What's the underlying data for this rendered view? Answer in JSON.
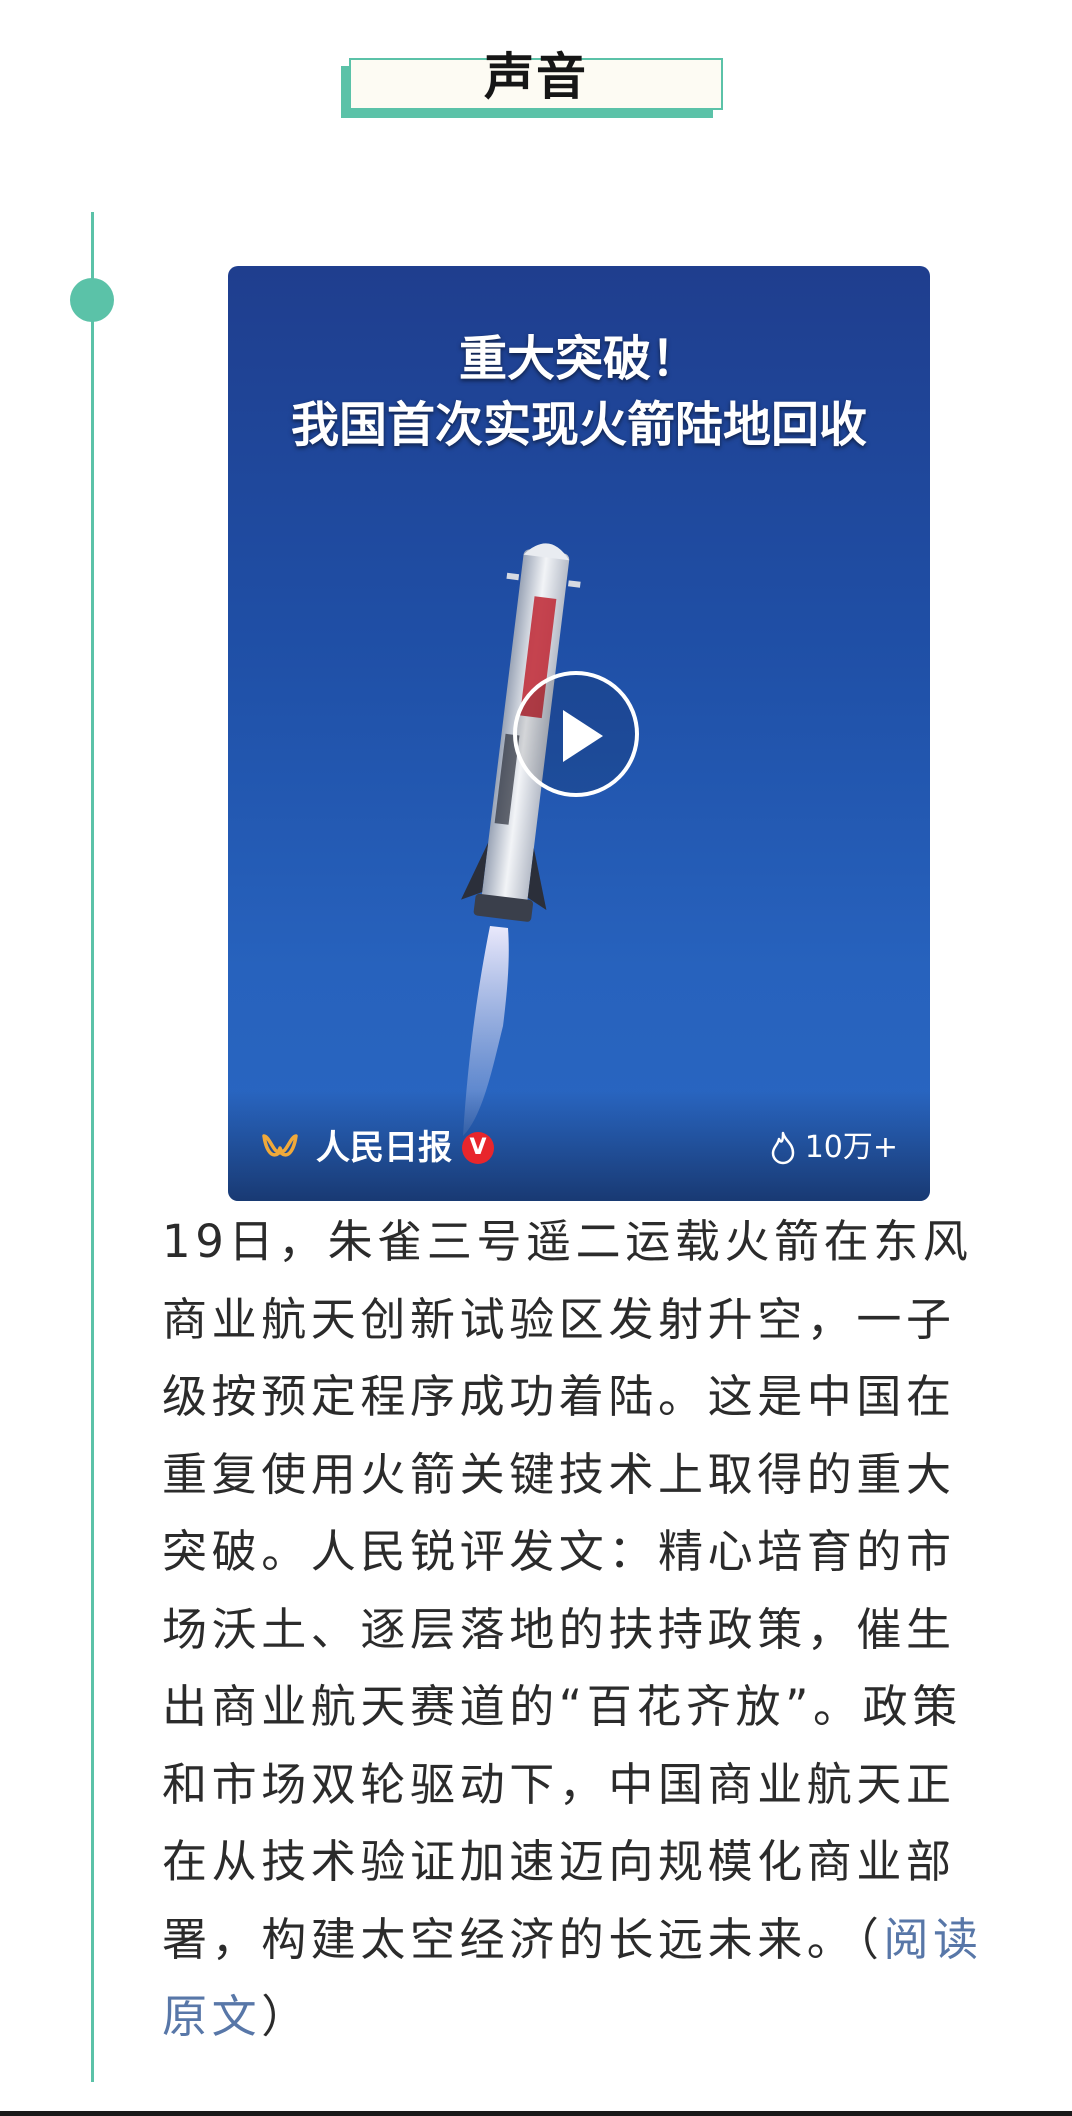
{
  "section": {
    "title": "声音"
  },
  "video": {
    "headline_line1": "重大突破！",
    "headline_line2": "我国首次实现火箭陆地回收",
    "source_name": "人民日报",
    "verified_mark": "V",
    "likes": "10万+",
    "icons": {
      "play": "play-icon",
      "source_logo": "renmin-logo-icon",
      "verified": "verified-badge-icon",
      "likes": "fire-icon"
    }
  },
  "article": {
    "body": "19日，朱雀三号遥二运载火箭在东风商业航天创新试验区发射升空，一子级按预定程序成功着陆。这是中国在重复使用火箭关键技术上取得的重大突破。人民锐评发文：精心培育的市场沃土、逐层落地的扶持政策，催生出商业航天赛道的“百花齐放”。政策和市场双轮驱动下，中国商业航天正在从技术验证加速迈向规模化商业部署，构建太空经济的长远未来。（",
    "link_text": "阅读原文",
    "closing": "）"
  },
  "colors": {
    "accent": "#5bc2a8",
    "link": "#5877a8",
    "text": "#2b2b2b",
    "badge": "#e8262c"
  }
}
